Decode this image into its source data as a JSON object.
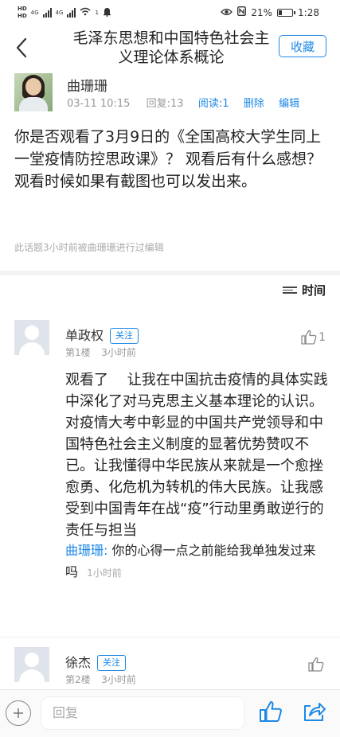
{
  "status_bar": {
    "network_left_1": "HD",
    "network_left_2": "HD",
    "signal_label_1": "4G",
    "signal_label_2": "4G",
    "hotspot_label": "1",
    "battery_percent": "21%",
    "time": "1:28"
  },
  "header": {
    "title": "毛泽东思想和中国特色社会主义理论体系概论",
    "collect_label": "收藏"
  },
  "post": {
    "author": "曲珊珊",
    "date": "03-11 10:15",
    "reply_count": "回复:13",
    "read_count": "阅读:1",
    "delete_label": "删除",
    "edit_label": "编辑",
    "body": "你是否观看了3月9日的《全国高校大学生同上一堂疫情防控思政课》？ 观看后有什么感想？观看时候如果有截图也可以发出来。",
    "edit_note": "此话题3小时前被曲珊珊进行过编辑"
  },
  "sort": {
    "label": "时间"
  },
  "comments": [
    {
      "name": "单政权",
      "follow_label": "关注",
      "floor": "第1楼",
      "time": "3小时前",
      "likes": "1",
      "body": "观看了　 让我在中国抗击疫情的具体实践中深化了对马克思主义基本理论的认识。对疫情大考中彰显的中国共产党领导和中国特色社会主义制度的显著优势赞叹不已。让我懂得中华民族从来就是一个愈挫愈勇、化危机为转机的伟大民族。让我感受到中国青年在战“疫”行动里勇敢逆行的责任与担当",
      "reply": {
        "name": "曲珊珊:",
        "text": "你的心得一点之前能给我单独发过来吗",
        "time": "1小时前"
      }
    },
    {
      "name": "徐杰",
      "follow_label": "关注",
      "floor": "第2楼",
      "time": "3小时前",
      "likes": ""
    }
  ],
  "bottom_bar": {
    "reply_placeholder": "回复"
  },
  "colors": {
    "accent": "#1e88e5",
    "meta_text": "#999999",
    "divider": "#f3f3f3"
  },
  "icons": [
    "back-icon",
    "thumb-up-icon",
    "add-icon",
    "share-icon",
    "sort-icon",
    "eye-icon",
    "nfc-icon",
    "battery-icon",
    "wifi-icon",
    "signal-icon",
    "alarm-icon"
  ]
}
